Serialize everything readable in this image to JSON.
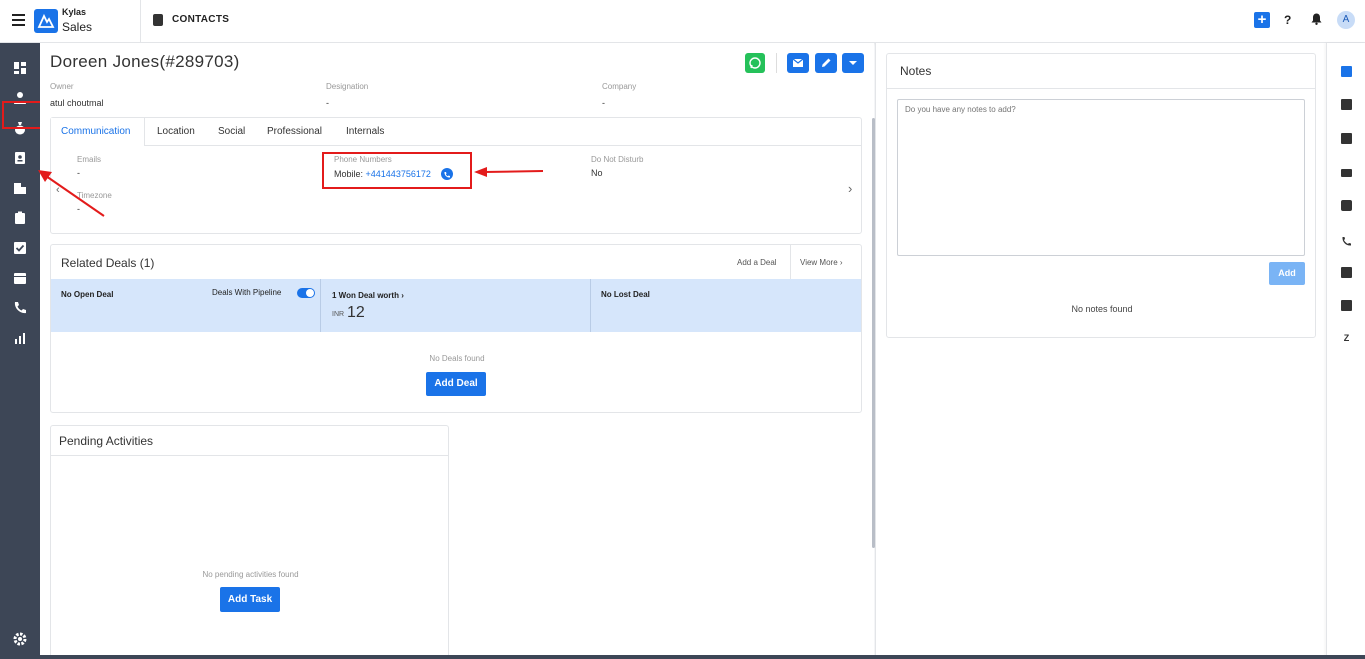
{
  "app": {
    "brand_top": "Kylas",
    "brand_bottom": "Sales",
    "module_title": "CONTACTS",
    "avatar_letter": "A",
    "help_label": "?"
  },
  "contact": {
    "name": "Doreen Jones(#289703)",
    "owner_label": "Owner",
    "owner_value": "atul choutmal",
    "designation_label": "Designation",
    "designation_value": "-",
    "company_label": "Company",
    "company_value": "-"
  },
  "tabs": [
    "Communication",
    "Location",
    "Social",
    "Professional",
    "Internals"
  ],
  "communication": {
    "emails_label": "Emails",
    "emails_value": "-",
    "phone_label": "Phone Numbers",
    "phone_prefix": "Mobile:",
    "phone_value": "+441443756172",
    "dnd_label": "Do Not Disturb",
    "dnd_value": "No",
    "timezone_label": "Timezone",
    "timezone_value": "-"
  },
  "deals": {
    "title": "Related Deals (1)",
    "add_link": "Add a Deal",
    "view_more": "View More",
    "open_label": "No Open Deal",
    "pipeline_toggle_label": "Deals With Pipeline",
    "won_label": "1 Won Deal worth",
    "won_currency": "INR",
    "won_amount": "12",
    "lost_label": "No Lost Deal",
    "empty_message": "No Deals found",
    "add_button": "Add Deal"
  },
  "activities": {
    "title": "Pending Activities",
    "empty_message": "No pending activities found",
    "add_button": "Add Task"
  },
  "notes": {
    "title": "Notes",
    "placeholder": "Do you have any notes to add?",
    "add_button": "Add",
    "empty_message": "No notes found"
  },
  "colors": {
    "accent": "#1a73e8",
    "highlight": "#e31b1b",
    "sidebar": "#3d4656",
    "whatsapp": "#25c15a"
  }
}
